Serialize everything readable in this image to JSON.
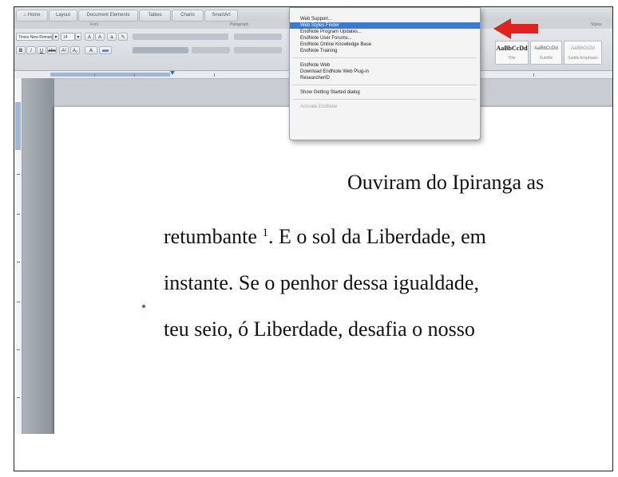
{
  "ribbon": {
    "tabs": [
      "Home",
      "Layout",
      "Document Elements",
      "Tables",
      "Charts",
      "SmartArt"
    ],
    "groups": [
      "Font",
      "Paragraph",
      "Styles"
    ],
    "font_name": "Times New Roman",
    "font_size": "14",
    "style_sample": "AaBbCcDd",
    "style_names": [
      "Title",
      "Subtitle",
      "Subtle Emphasis"
    ]
  },
  "menu": {
    "group1": [
      "Web Support...",
      "Web Styles Finder",
      "EndNote Program Updates...",
      "EndNote User Forums...",
      "EndNote Online Knowledge Base",
      "EndNote Training"
    ],
    "group2": [
      "EndNote Web",
      "Download EndNote Web Plug-in",
      "ResearcherID"
    ],
    "group3": [
      "Show Getting Started dialog"
    ],
    "group4": [
      "Activate EndNote"
    ],
    "highlighted": "Web Styles Finder"
  },
  "document": {
    "line1": "Ouviram do Ipiranga as",
    "line2_pre": "retumbante ",
    "line2_sup": "1",
    "line2_post": ". E o sol da Liberdade, em",
    "line3": "instante. Se o penhor dessa igualdade,",
    "line4": "teu seio, ó Liberdade, desafia o nosso"
  },
  "colors": {
    "arrow": "#e0231c",
    "menu_highlight": "#3d78d3"
  }
}
